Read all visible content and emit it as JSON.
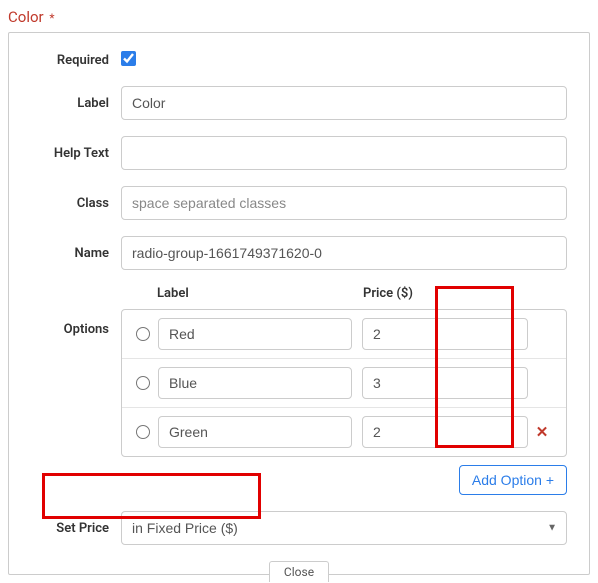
{
  "title": "Color",
  "asterisk": "*",
  "fields": {
    "required_label": "Required",
    "required_checked": true,
    "label_label": "Label",
    "label_value": "Color",
    "help_label": "Help Text",
    "help_value": "",
    "class_label": "Class",
    "class_placeholder": "space separated classes",
    "class_value": "",
    "name_label": "Name",
    "name_value": "radio-group-1661749371620-0",
    "options_label": "Options",
    "setprice_label": "Set Price",
    "setprice_value": "in Fixed Price ($)"
  },
  "options_header": {
    "label": "Label",
    "price": "Price ($)"
  },
  "options": [
    {
      "label": "Red",
      "price": "2",
      "removable": false
    },
    {
      "label": "Blue",
      "price": "3",
      "removable": false
    },
    {
      "label": "Green",
      "price": "2",
      "removable": true
    }
  ],
  "buttons": {
    "add_option": "Add Option +",
    "close": "Close"
  },
  "remove_symbol": "✕"
}
